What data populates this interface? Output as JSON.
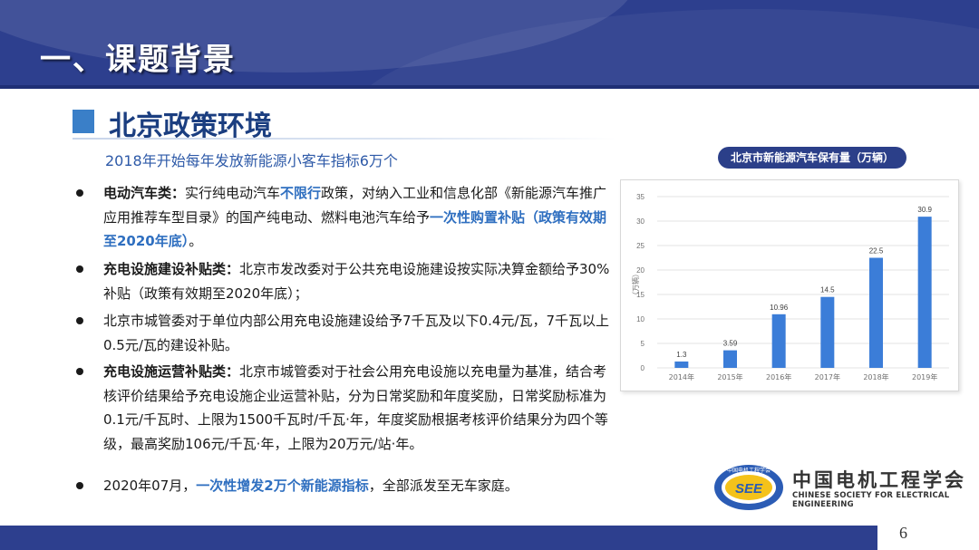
{
  "header": {
    "title": "一、课题背景"
  },
  "section": {
    "title": "北京政策环境",
    "subtitle": "2018年开始每年发放新能源小客车指标6万个"
  },
  "bullets": [
    {
      "parts": [
        {
          "t": "电动汽车类：",
          "s": "bold"
        },
        {
          "t": "实行纯电动汽车",
          "s": ""
        },
        {
          "t": "不限行",
          "s": "hl"
        },
        {
          "t": "政策，对纳入工业和信息化部《新能源汽车推广应用推荐车型目录》的国产纯电动、燃料电池汽车给予",
          "s": ""
        },
        {
          "t": "一次性购置补贴（政策有效期至2020年底）",
          "s": "hl"
        },
        {
          "t": "。",
          "s": ""
        }
      ]
    },
    {
      "parts": [
        {
          "t": "充电设施建设补贴类：",
          "s": "bold"
        },
        {
          "t": "北京市发改委对于公共充电设施建设按实际决算金额给予30%补贴（政策有效期至2020年底）；",
          "s": ""
        }
      ]
    },
    {
      "parts": [
        {
          "t": "北京市城管委对于单位内部公用充电设施建设给予7千瓦及以下0.4元/瓦，7千瓦以上0.5元/瓦的建设补贴。",
          "s": ""
        }
      ]
    },
    {
      "parts": [
        {
          "t": "充电设施运营补贴类：",
          "s": "bold"
        },
        {
          "t": "北京市城管委对于社会公用充电设施以充电量为基准，结合考核评价结果给予充电设施企业运营补贴，分为日常奖励和年度奖励，日常奖励标准为0.1元/千瓦时、上限为1500千瓦时/千瓦·年，年度奖励根据考核评价结果分为四个等级，最高奖励106元/千瓦·年，上限为20万元/站·年。",
          "s": ""
        }
      ]
    },
    {
      "parts": [
        {
          "t": "2020年07月，",
          "s": ""
        },
        {
          "t": "一次性增发2万个新能源指标",
          "s": "hl"
        },
        {
          "t": "，全部派发至无车家庭。",
          "s": ""
        }
      ]
    }
  ],
  "chart_data": {
    "type": "bar",
    "title": "北京市新能源汽车保有量（万辆）",
    "categories": [
      "2014年",
      "2015年",
      "2016年",
      "2017年",
      "2018年",
      "2019年"
    ],
    "values": [
      1.3,
      3.59,
      10.96,
      14.5,
      22.5,
      30.9
    ],
    "value_labels": [
      "1.3",
      "3.59",
      "10.96",
      "14.5",
      "22.5",
      "30.9"
    ],
    "ylabel": "（万辆）",
    "ylim": [
      0,
      35
    ],
    "yticks": [
      0,
      5,
      10,
      15,
      20,
      25,
      30,
      35
    ],
    "grid": true,
    "bar_color": "#3b7dd8"
  },
  "logo": {
    "name_cn": "中国电机工程学会",
    "name_en": "CHINESE SOCIETY FOR ELECTRICAL ENGINEERING",
    "emblem_text": "SEE",
    "emblem_ring": "中国电机工程学会"
  },
  "footer": {
    "page_number": "6"
  }
}
